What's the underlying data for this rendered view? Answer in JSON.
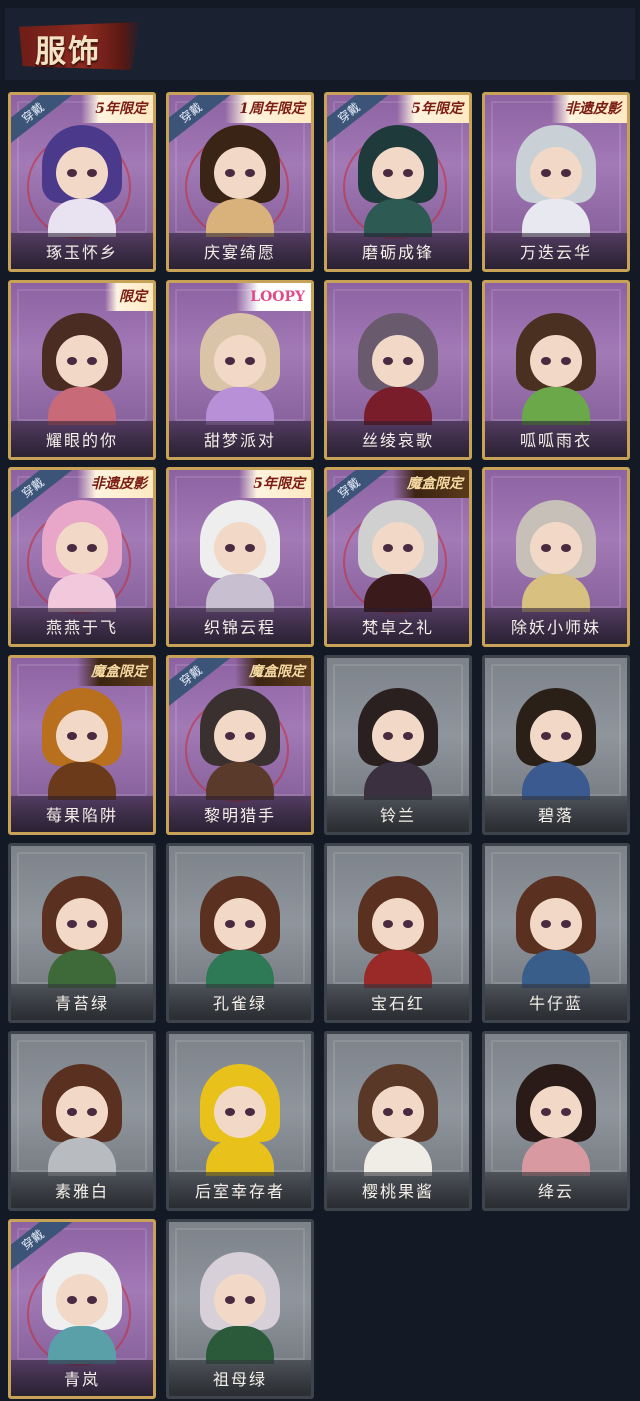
{
  "header": {
    "title": "服饰"
  },
  "colors": {
    "purple_card": "#a27ab6",
    "gray_card": "#8f959c",
    "gold_border": "#c7a257",
    "wear_tag": "#3c5478"
  },
  "cards": [
    {
      "name": "琢玉怀乡",
      "style": "purple",
      "badge": "5年限定",
      "badge_style": "normal",
      "worn": true,
      "wear_label": "穿戴",
      "hair": "#4b3a8c",
      "outfit": "#e9e2f0"
    },
    {
      "name": "庆宴绮愿",
      "style": "purple",
      "badge": "1周年限定",
      "badge_style": "normal",
      "worn": true,
      "wear_label": "穿戴",
      "hair": "#3a2416",
      "outfit": "#d8b27a"
    },
    {
      "name": "磨砺成锋",
      "style": "purple",
      "badge": "5年限定",
      "badge_style": "normal",
      "worn": true,
      "wear_label": "穿戴",
      "hair": "#1f3a3a",
      "outfit": "#2d5a52"
    },
    {
      "name": "万迭云华",
      "style": "purple",
      "badge": "非遗皮影",
      "badge_style": "normal",
      "worn": false,
      "hair": "#c9d0d6",
      "outfit": "#e8e8f0"
    },
    {
      "name": "耀眼的你",
      "style": "purple",
      "badge": "限定",
      "badge_style": "normal",
      "worn": false,
      "hair": "#4a2c22",
      "outfit": "#c86a78"
    },
    {
      "name": "甜梦派对",
      "style": "purple",
      "badge": "LOOPY",
      "badge_style": "pink",
      "worn": false,
      "hair": "#d9c4a8",
      "outfit": "#b890d8"
    },
    {
      "name": "丝绫哀歌",
      "style": "purple",
      "badge": "",
      "worn": false,
      "hair": "#6a5a6e",
      "outfit": "#7a1d2a"
    },
    {
      "name": "呱呱雨衣",
      "style": "purple",
      "badge": "",
      "worn": false,
      "hair": "#4a3020",
      "outfit": "#6aa84a"
    },
    {
      "name": "燕燕于飞",
      "style": "purple",
      "badge": "非遗皮影",
      "badge_style": "normal",
      "worn": true,
      "wear_label": "穿戴",
      "hair": "#e8a6c8",
      "outfit": "#f2c8dc"
    },
    {
      "name": "织锦云程",
      "style": "purple",
      "badge": "5年限定",
      "badge_style": "normal",
      "worn": false,
      "hair": "#eeeeee",
      "outfit": "#c8c0d0"
    },
    {
      "name": "梵卓之礼",
      "style": "purple",
      "badge": "魔盒限定",
      "badge_style": "dark",
      "worn": true,
      "wear_label": "穿戴",
      "hair": "#d0d0d0",
      "outfit": "#3a1a1a"
    },
    {
      "name": "除妖小师妹",
      "style": "purple",
      "badge": "",
      "worn": false,
      "hair": "#c6c0b8",
      "outfit": "#d8c080"
    },
    {
      "name": "莓果陷阱",
      "style": "purple",
      "badge": "魔盒限定",
      "badge_style": "dark",
      "worn": false,
      "hair": "#b8701e",
      "outfit": "#6a3a1a"
    },
    {
      "name": "黎明猎手",
      "style": "purple",
      "badge": "魔盒限定",
      "badge_style": "dark",
      "worn": true,
      "wear_label": "穿戴",
      "hair": "#3a3030",
      "outfit": "#5a3a2a"
    },
    {
      "name": "铃兰",
      "style": "gray",
      "badge": "",
      "worn": false,
      "hair": "#2a2020",
      "outfit": "#3a3040"
    },
    {
      "name": "碧落",
      "style": "gray",
      "badge": "",
      "worn": false,
      "hair": "#2a2018",
      "outfit": "#3a5a90"
    },
    {
      "name": "青苔绿",
      "style": "gray",
      "badge": "",
      "worn": false,
      "hair": "#5a3020",
      "outfit": "#3e6a3a"
    },
    {
      "name": "孔雀绿",
      "style": "gray",
      "badge": "",
      "worn": false,
      "hair": "#5a3020",
      "outfit": "#2f7a56"
    },
    {
      "name": "宝石红",
      "style": "gray",
      "badge": "",
      "worn": false,
      "hair": "#5a3020",
      "outfit": "#9a2a28"
    },
    {
      "name": "牛仔蓝",
      "style": "gray",
      "badge": "",
      "worn": false,
      "hair": "#5a3020",
      "outfit": "#3a5e8a"
    },
    {
      "name": "素雅白",
      "style": "gray",
      "badge": "",
      "worn": false,
      "hair": "#5a3020",
      "outfit": "#b8bcc0"
    },
    {
      "name": "后室幸存者",
      "style": "gray",
      "badge": "",
      "worn": false,
      "hair": "#e8c21a",
      "outfit": "#e8c21a"
    },
    {
      "name": "樱桃果酱",
      "style": "gray",
      "badge": "",
      "worn": false,
      "hair": "#5a3828",
      "outfit": "#f0ece6"
    },
    {
      "name": "绛云",
      "style": "gray",
      "badge": "",
      "worn": false,
      "hair": "#2a1a18",
      "outfit": "#d89aa0"
    },
    {
      "name": "青岚",
      "style": "purple",
      "badge": "",
      "worn": true,
      "wear_label": "穿戴",
      "hair": "#efefef",
      "outfit": "#5aa0a8"
    },
    {
      "name": "祖母绿",
      "style": "gray",
      "badge": "",
      "worn": false,
      "hair": "#d8d0d8",
      "outfit": "#2a5a3a"
    }
  ]
}
